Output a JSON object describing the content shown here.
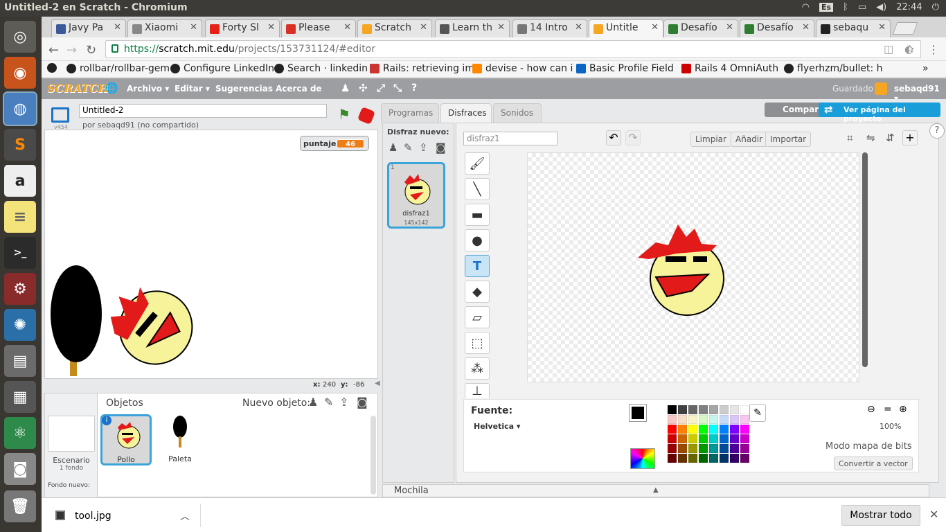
{
  "os": {
    "window_title": "Untitled-2 en Scratch - Chromium",
    "keyboard_layout": "Es",
    "clock": "22:44"
  },
  "launcher": [
    "ubuntu-icon",
    "firefox-icon",
    "chromium-icon",
    "sublime-icon",
    "amazon-icon",
    "notes-icon",
    "terminal-icon",
    "settings-icon",
    "kde-icon",
    "files-icon",
    "workspace-icon",
    "atom-icon",
    "camera-icon",
    "trash-icon"
  ],
  "browser": {
    "tabs": [
      {
        "label": "Javy Pa",
        "color": "#3b5998"
      },
      {
        "label": "Xiaomi",
        "color": "#888888"
      },
      {
        "label": "Forty Sl",
        "color": "#e62117"
      },
      {
        "label": "Please",
        "color": "#d93025"
      },
      {
        "label": "Scratch",
        "color": "#f6a623"
      },
      {
        "label": "Learn th",
        "color": "#555555"
      },
      {
        "label": "14 Intro",
        "color": "#777777"
      },
      {
        "label": "Untitle",
        "color": "#f6a623"
      },
      {
        "label": "Desafío",
        "color": "#2e7d32"
      },
      {
        "label": "Desafío",
        "color": "#2e7d32"
      },
      {
        "label": "sebaqu",
        "color": "#222222"
      }
    ],
    "url_scheme": "https://",
    "url_host": "scratch.mit.edu",
    "url_path": "/projects/153731124/#editor",
    "bookmarks": [
      "rollbar/rollbar-gem",
      "Configure LinkedIn",
      "Search · linkedin",
      "Rails: retrieving im",
      "devise - how can i",
      "Basic Profile Field",
      "Rails 4 OmniAuth",
      "flyerhzm/bullet: h"
    ],
    "bookmarks_more": "»"
  },
  "scratch": {
    "logo": "SCRATCH",
    "menu": [
      "Archivo ▾",
      "Editar ▾",
      "Sugerencias",
      "Acerca de"
    ],
    "saved_status": "Guardado",
    "username": "sebaqd91 ▾",
    "share_button": "Compartir",
    "project_page_button": "Ver página del proyecto",
    "project_title": "Untitled-2",
    "author": "por sebaqd91 (no compartido)",
    "version": "v454",
    "variable_label": "puntaje",
    "variable_value": "46",
    "mouse_x_label": "x:",
    "mouse_x": "240",
    "mouse_y_label": "y:",
    "mouse_y": "-86",
    "sprites_header": "Objetos",
    "new_sprite_label": "Nuevo objeto:",
    "stage_label": "Escenario",
    "stage_backdrops": "1 fondo",
    "new_backdrop_label": "Fondo nuevo:",
    "sprites": [
      {
        "name": "Pollo"
      },
      {
        "name": "Paleta"
      }
    ],
    "editor_tabs": [
      "Programas",
      "Disfraces",
      "Sonidos"
    ],
    "active_editor_tab": "Disfraces",
    "new_costume_label": "Disfraz nuevo:",
    "costumes": [
      {
        "index": "1",
        "name": "disfraz1",
        "size": "145x142"
      }
    ],
    "costume_name_value": "disfraz1",
    "paint_buttons": [
      "Limpiar",
      "Añadir",
      "Importar"
    ],
    "font_label": "Fuente:",
    "font_value": "Helvetica ▾",
    "zoom": "100%",
    "bitmap_mode": "Modo mapa de bits",
    "convert_button": "Convertir a vector",
    "backpack": "Mochila",
    "primary_color": "#000000",
    "palette": [
      "#000000",
      "#404040",
      "#666666",
      "#808080",
      "#a6a6a6",
      "#cccccc",
      "#e6e6e6",
      "#ffffff",
      "#f7c6c6",
      "#f7dcc6",
      "#f7f3c6",
      "#d9f7c6",
      "#c6f7ef",
      "#c6d9f7",
      "#dcc6f7",
      "#f7c6ef",
      "#ff0000",
      "#ff8000",
      "#ffff00",
      "#00ff00",
      "#00ffff",
      "#0080ff",
      "#8000ff",
      "#ff00ff",
      "#cc0000",
      "#cc6600",
      "#cccc00",
      "#00cc00",
      "#00cccc",
      "#0066cc",
      "#6600cc",
      "#cc00cc",
      "#990000",
      "#994c00",
      "#999900",
      "#009900",
      "#009999",
      "#004c99",
      "#4c0099",
      "#990099",
      "#660000",
      "#663300",
      "#666600",
      "#006600",
      "#006666",
      "#003366",
      "#330066",
      "#660066"
    ]
  },
  "downloads": {
    "file": "tool.jpg",
    "show_all": "Mostrar todo"
  }
}
